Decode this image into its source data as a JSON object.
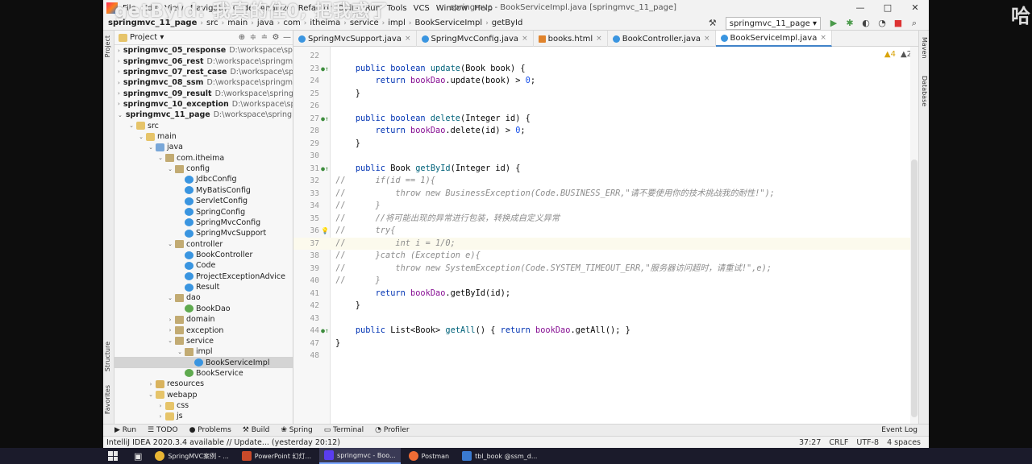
{
  "overlay_text": "getById: 我真的住0, 把我惑了",
  "right_glyph": "哈",
  "menu": [
    "File",
    "Edit",
    "View",
    "Navigate",
    "Code",
    "Analyze",
    "Refactor",
    "Build",
    "Run",
    "Tools",
    "VCS",
    "Window",
    "Help"
  ],
  "window_title": "springmvc - BookServiceImpl.java [springmvc_11_page]",
  "window_controls": [
    "—",
    "□",
    "✕"
  ],
  "breadcrumbs": [
    "springmvc_11_page",
    "src",
    "main",
    "java",
    "com",
    "itheima",
    "service",
    "impl",
    "BookServiceImpl",
    "getById"
  ],
  "run_config": "springmvc_11_page",
  "project_panel": {
    "title": "Project",
    "tree": [
      {
        "depth": 0,
        "arrow": "›",
        "icon": "module",
        "label": "springmvc_05_response",
        "bold": true,
        "path": "D:\\workspace\\springmvc\\"
      },
      {
        "depth": 0,
        "arrow": "›",
        "icon": "module",
        "label": "springmvc_06_rest",
        "bold": true,
        "path": "D:\\workspace\\springmvc\\s"
      },
      {
        "depth": 0,
        "arrow": "›",
        "icon": "module",
        "label": "springmvc_07_rest_case",
        "bold": true,
        "path": "D:\\workspace\\springm"
      },
      {
        "depth": 0,
        "arrow": "›",
        "icon": "module",
        "label": "springmvc_08_ssm",
        "bold": true,
        "path": "D:\\workspace\\springmvc\\s"
      },
      {
        "depth": 0,
        "arrow": "›",
        "icon": "module",
        "label": "springmvc_09_result",
        "bold": true,
        "path": "D:\\workspace\\springmvc"
      },
      {
        "depth": 0,
        "arrow": "›",
        "icon": "module",
        "label": "springmvc_10_exception",
        "bold": true,
        "path": "D:\\workspace\\spring"
      },
      {
        "depth": 0,
        "arrow": "⌄",
        "icon": "module",
        "label": "springmvc_11_page",
        "bold": true,
        "path": "D:\\workspace\\springmvc\\"
      },
      {
        "depth": 1,
        "arrow": "⌄",
        "icon": "folder",
        "label": "src",
        "bold": false,
        "path": ""
      },
      {
        "depth": 2,
        "arrow": "⌄",
        "icon": "folder",
        "label": "main",
        "bold": false,
        "path": ""
      },
      {
        "depth": 3,
        "arrow": "⌄",
        "icon": "src",
        "label": "java",
        "bold": false,
        "path": ""
      },
      {
        "depth": 4,
        "arrow": "⌄",
        "icon": "pkg",
        "label": "com.itheima",
        "bold": false,
        "path": ""
      },
      {
        "depth": 5,
        "arrow": "⌄",
        "icon": "pkg",
        "label": "config",
        "bold": false,
        "path": ""
      },
      {
        "depth": 6,
        "arrow": "",
        "icon": "class",
        "label": "JdbcConfig",
        "bold": false,
        "path": ""
      },
      {
        "depth": 6,
        "arrow": "",
        "icon": "class",
        "label": "MyBatisConfig",
        "bold": false,
        "path": ""
      },
      {
        "depth": 6,
        "arrow": "",
        "icon": "class",
        "label": "ServletConfig",
        "bold": false,
        "path": ""
      },
      {
        "depth": 6,
        "arrow": "",
        "icon": "class",
        "label": "SpringConfig",
        "bold": false,
        "path": ""
      },
      {
        "depth": 6,
        "arrow": "",
        "icon": "class",
        "label": "SpringMvcConfig",
        "bold": false,
        "path": ""
      },
      {
        "depth": 6,
        "arrow": "",
        "icon": "class",
        "label": "SpringMvcSupport",
        "bold": false,
        "path": ""
      },
      {
        "depth": 5,
        "arrow": "⌄",
        "icon": "pkg",
        "label": "controller",
        "bold": false,
        "path": ""
      },
      {
        "depth": 6,
        "arrow": "",
        "icon": "class",
        "label": "BookController",
        "bold": false,
        "path": ""
      },
      {
        "depth": 6,
        "arrow": "",
        "icon": "class",
        "label": "Code",
        "bold": false,
        "path": ""
      },
      {
        "depth": 6,
        "arrow": "",
        "icon": "class",
        "label": "ProjectExceptionAdvice",
        "bold": false,
        "path": ""
      },
      {
        "depth": 6,
        "arrow": "",
        "icon": "class",
        "label": "Result",
        "bold": false,
        "path": ""
      },
      {
        "depth": 5,
        "arrow": "⌄",
        "icon": "pkg",
        "label": "dao",
        "bold": false,
        "path": ""
      },
      {
        "depth": 6,
        "arrow": "",
        "icon": "iface",
        "label": "BookDao",
        "bold": false,
        "path": ""
      },
      {
        "depth": 5,
        "arrow": "›",
        "icon": "pkg",
        "label": "domain",
        "bold": false,
        "path": ""
      },
      {
        "depth": 5,
        "arrow": "›",
        "icon": "pkg",
        "label": "exception",
        "bold": false,
        "path": ""
      },
      {
        "depth": 5,
        "arrow": "⌄",
        "icon": "pkg",
        "label": "service",
        "bold": false,
        "path": ""
      },
      {
        "depth": 6,
        "arrow": "⌄",
        "icon": "pkg",
        "label": "impl",
        "bold": false,
        "path": ""
      },
      {
        "depth": 7,
        "arrow": "",
        "icon": "class",
        "label": "BookServiceImpl",
        "bold": false,
        "path": "",
        "selected": true
      },
      {
        "depth": 6,
        "arrow": "",
        "icon": "iface",
        "label": "BookService",
        "bold": false,
        "path": ""
      },
      {
        "depth": 3,
        "arrow": "›",
        "icon": "res",
        "label": "resources",
        "bold": false,
        "path": ""
      },
      {
        "depth": 3,
        "arrow": "⌄",
        "icon": "folder",
        "label": "webapp",
        "bold": false,
        "path": ""
      },
      {
        "depth": 4,
        "arrow": "›",
        "icon": "folder",
        "label": "css",
        "bold": false,
        "path": ""
      },
      {
        "depth": 4,
        "arrow": "›",
        "icon": "folder",
        "label": "js",
        "bold": false,
        "path": ""
      }
    ]
  },
  "tabs": [
    {
      "label": "SpringMvcSupport.java",
      "type": "class",
      "active": false
    },
    {
      "label": "SpringMvcConfig.java",
      "type": "class",
      "active": false
    },
    {
      "label": "books.html",
      "type": "html",
      "active": false
    },
    {
      "label": "BookController.java",
      "type": "class",
      "active": false
    },
    {
      "label": "BookServiceImpl.java",
      "type": "class",
      "active": true
    }
  ],
  "editor": {
    "warnings": "▲4",
    "weak_warnings": "▲2",
    "lines": [
      {
        "n": "22",
        "html": ""
      },
      {
        "n": "23",
        "mark": "●↑",
        "html": "    <span class=\"kw\">public boolean</span> <span class=\"fn\">update</span>(Book book) {"
      },
      {
        "n": "24",
        "html": "        <span class=\"kw\">return</span> <span class=\"fld\">bookDao</span>.update(book) &gt; <span class=\"num\">0</span>;"
      },
      {
        "n": "25",
        "html": "    }"
      },
      {
        "n": "26",
        "html": ""
      },
      {
        "n": "27",
        "mark": "●↑",
        "html": "    <span class=\"kw\">public boolean</span> <span class=\"fn\">delete</span>(Integer id) {"
      },
      {
        "n": "28",
        "html": "        <span class=\"kw\">return</span> <span class=\"fld\">bookDao</span>.delete(id) &gt; <span class=\"num\">0</span>;"
      },
      {
        "n": "29",
        "html": "    }"
      },
      {
        "n": "30",
        "html": ""
      },
      {
        "n": "31",
        "mark": "●↑",
        "html": "    <span class=\"kw\">public</span> Book <span class=\"fn\">getById</span>(Integer id) {"
      },
      {
        "n": "32",
        "comment": true,
        "html": "<span class=\"cm\">        if(id == 1){</span>"
      },
      {
        "n": "33",
        "comment": true,
        "html": "<span class=\"cm\">            throw new BusinessException(Code.BUSINESS_ERR,\"请不要使用你的技术挑战我的耐性!\");</span>"
      },
      {
        "n": "34",
        "comment": true,
        "html": "<span class=\"cm\">        }</span>"
      },
      {
        "n": "35",
        "comment": true,
        "html": "<span class=\"cm\">        //将可能出现的异常进行包装，转换成自定义异常</span>"
      },
      {
        "n": "36",
        "comment": true,
        "mark": "💡",
        "html": "<span class=\"cm\">        try{</span>"
      },
      {
        "n": "37",
        "comment": true,
        "current": true,
        "html": "<span class=\"cm\">            int i = 1/0;</span>"
      },
      {
        "n": "38",
        "comment": true,
        "html": "<span class=\"cm\">        }catch (Exception e){</span>"
      },
      {
        "n": "39",
        "comment": true,
        "html": "<span class=\"cm\">            throw new SystemException(Code.SYSTEM_TIMEOUT_ERR,\"服务器访问超时，请重试!\",e);</span>"
      },
      {
        "n": "40",
        "comment": true,
        "html": "<span class=\"cm\">        }</span>"
      },
      {
        "n": "41",
        "html": "        <span class=\"kw\">return</span> <span class=\"fld\">bookDao</span>.getById(id);"
      },
      {
        "n": "42",
        "html": "    }"
      },
      {
        "n": "43",
        "html": ""
      },
      {
        "n": "44",
        "mark": "●↑",
        "html": "    <span class=\"kw\">public</span> List&lt;Book&gt; <span class=\"fn\">getAll</span>() { <span class=\"kw\">return</span> <span class=\"fld\">bookDao</span>.getAll(); }"
      },
      {
        "n": "47",
        "html": "}"
      },
      {
        "n": "48",
        "html": ""
      }
    ]
  },
  "left_stripe": [
    "Project",
    "Structure",
    "Favorites"
  ],
  "right_stripe": [
    "Maven",
    "Database"
  ],
  "tool_windows": [
    "▶ Run",
    "☰ TODO",
    "● Problems",
    "⚒ Build",
    "❀ Spring",
    "▭ Terminal",
    "◔ Profiler"
  ],
  "event_log": "Event Log",
  "status_message": "IntelliJ IDEA 2020.3.4 available // Update... (yesterday 20:12)",
  "status_right": [
    "37:27",
    "CRLF",
    "UTF-8",
    "4 spaces"
  ],
  "taskbar": [
    {
      "label": "SpringMVC案例 - ...",
      "color": "#e9b634",
      "round": true
    },
    {
      "label": "PowerPoint 幻灯...",
      "color": "#c94a2a",
      "round": false
    },
    {
      "label": "springmvc - Boo...",
      "color": "#5a3df0",
      "round": false,
      "active": true
    },
    {
      "label": "Postman",
      "color": "#ef6c35",
      "round": true
    },
    {
      "label": "tbl_book @ssm_d...",
      "color": "#3a7ad0",
      "round": false
    }
  ]
}
